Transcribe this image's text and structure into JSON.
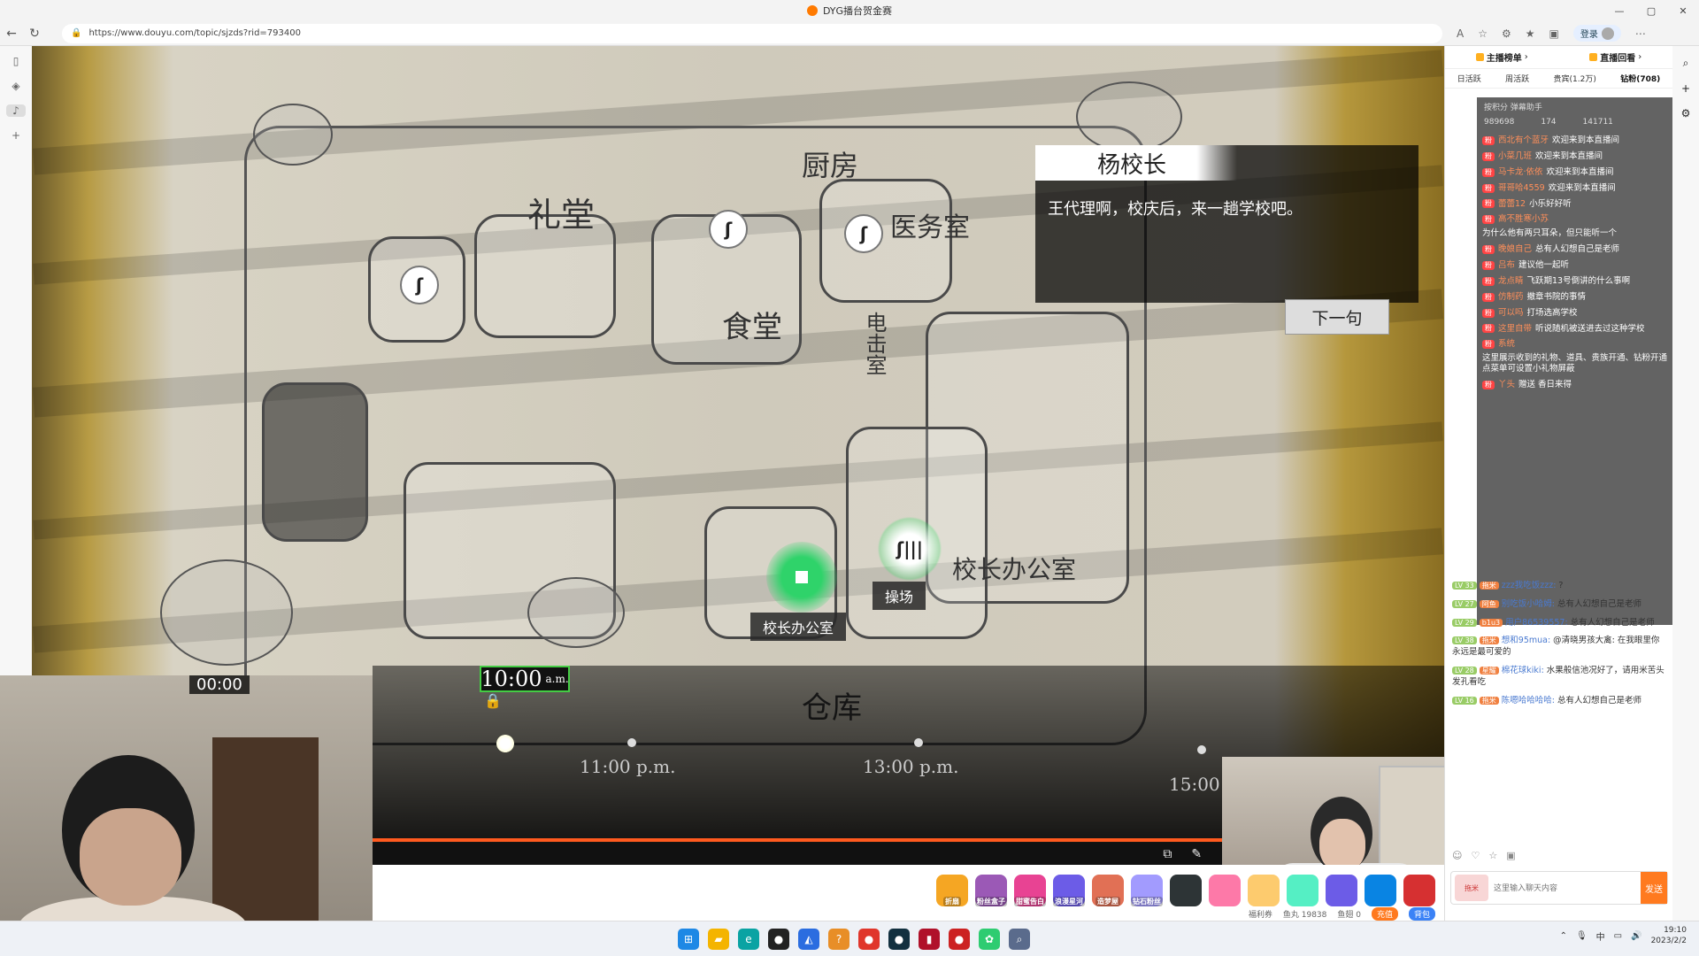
{
  "window": {
    "title": "DYG播台贺金赛",
    "controls": [
      "—",
      "▢",
      "✕"
    ]
  },
  "address": {
    "url": "https://www.douyu.com/topic/sjzds?rid=793400",
    "login_label": "登录"
  },
  "game": {
    "speaker": "杨校长",
    "dialog": "王代理啊，校庆后，来一趟学校吧。",
    "next_button": "下一句",
    "place_office": "校长办公室",
    "place_playground": "操场",
    "clock_time": "10:00",
    "clock_ampm": "a.m.",
    "cam_timer": "00:00",
    "ticks": [
      "11:00 p.m.",
      "13:00 p.m.",
      "15:00"
    ],
    "map_labels": [
      "礼堂",
      "厨房",
      "医务室",
      "食堂",
      "校长办公室",
      "仓库",
      "电击室"
    ],
    "progress_fraction": 0.96
  },
  "gifts": [
    {
      "label": "折扇",
      "color": "#f5a623"
    },
    {
      "label": "粉丝盒子",
      "color": "#9b59b6"
    },
    {
      "label": "甜蜜告白",
      "color": "#e84393"
    },
    {
      "label": "浪漫星河",
      "color": "#6c5ce7"
    },
    {
      "label": "造梦屋",
      "color": "#e17055"
    },
    {
      "label": "钻石粉丝",
      "color": "#a29bfe"
    },
    {
      "label": "",
      "color": "#2d3436"
    },
    {
      "label": "",
      "color": "#fd79a8"
    },
    {
      "label": "",
      "color": "#fdcb6e"
    },
    {
      "label": "",
      "color": "#55efc4"
    },
    {
      "label": "",
      "color": "#6c5ce7"
    },
    {
      "label": "",
      "color": "#0984e3"
    },
    {
      "label": "",
      "color": "#d63031"
    }
  ],
  "statusbar": {
    "fuli": "福利券",
    "yuwan": "鱼丸 19838",
    "yuchi": "鱼翅 0",
    "recharge": "充值",
    "bag": "背包"
  },
  "panel": {
    "tab_rank": "主播榜单",
    "tab_replay": "直播回看",
    "tabs": [
      "日活跃",
      "周活跃",
      "贵宾(1.2万)",
      "钻粉(708)"
    ],
    "overlay_title": "按积分 弹幕助手",
    "overlay_stats": [
      "989698",
      "174",
      "141711"
    ],
    "bullets": [
      {
        "user": "西北有个蓝牙",
        "text": "欢迎来到本直播间"
      },
      {
        "user": "小菜几班",
        "text": "欢迎来到本直播间"
      },
      {
        "user": "马卡龙·依依",
        "text": "欢迎来到本直播间"
      },
      {
        "user": "哥哥哈4559",
        "text": "欢迎来到本直播间"
      },
      {
        "user": "蕾蕾12",
        "text": "小乐好好听"
      },
      {
        "user": "高不胜寒小苏",
        "text": "为什么他有两只耳朵，但只能听一个"
      },
      {
        "user": "晚娘自己",
        "text": "总有人幻想自己是老师"
      },
      {
        "user": "吕布",
        "text": "建议他一起听"
      },
      {
        "user": "龙点睛",
        "text": "飞跃期13号倒讲的什么事啊"
      },
      {
        "user": "仿制药",
        "text": "撤章书院的事情"
      },
      {
        "user": "可以吗",
        "text": "打场选高学校"
      },
      {
        "user": "这里自带",
        "text": "听说随机被送进去过这种学校"
      },
      {
        "user": "系统",
        "text": "这里展示收到的礼物、道具、贵族开通、钻粉开通点菜单可设置小礼物屏蔽"
      },
      {
        "user": "丫头",
        "text": "赠送 香日来得"
      }
    ],
    "chat": [
      {
        "lv": "LV 33",
        "badge": "拖米",
        "user": "zzz我吃饭zzz:",
        "text": "?"
      },
      {
        "lv": "LV 27",
        "badge": "阿鱼",
        "user": "别吃饭小哈姆:",
        "text": "总有人幻想自己是老师"
      },
      {
        "lv": "LV 29",
        "badge": "b1u3",
        "user": "用户86539557:",
        "text": "总有人幻想自己是老师"
      },
      {
        "lv": "LV 38",
        "badge": "拖米",
        "user": "想和95mua:",
        "text": "@清晓男孩大禽: 在我眼里你永远是最可爱的"
      },
      {
        "lv": "LV 28",
        "badge": "星耀",
        "user": "棉花球kiki:",
        "text": "水果般信池况好了，请用米苦头发孔看吃"
      },
      {
        "lv": "LV 16",
        "badge": "拖米",
        "user": "陈嗯哈哈哈哈:",
        "text": "总有人幻想自己是老师"
      }
    ],
    "input_placeholder": "这里输入聊天内容",
    "send": "发送",
    "input_avatar": "拖米"
  },
  "taskbar": {
    "apps": [
      {
        "glyph": "⊞",
        "color": "#1e88e5"
      },
      {
        "glyph": "▰",
        "color": "#f4b400"
      },
      {
        "glyph": "e",
        "color": "#0aa3a3"
      },
      {
        "glyph": "●",
        "color": "#222"
      },
      {
        "glyph": "◭",
        "color": "#2b6de0"
      },
      {
        "glyph": "?",
        "color": "#e88e27"
      },
      {
        "glyph": "●",
        "color": "#e0362b"
      },
      {
        "glyph": "●",
        "color": "#12303f"
      },
      {
        "glyph": "▮",
        "color": "#b0112a"
      },
      {
        "glyph": "●",
        "color": "#cc2222"
      },
      {
        "glyph": "✿",
        "color": "#2ecc71"
      },
      {
        "glyph": "⌕",
        "color": "#5a6b8c"
      }
    ],
    "ime": "中",
    "time": "19:10",
    "date": "2023/2/2"
  },
  "colors": {
    "accent": "#ff7a1f",
    "green": "#3bd16f"
  }
}
